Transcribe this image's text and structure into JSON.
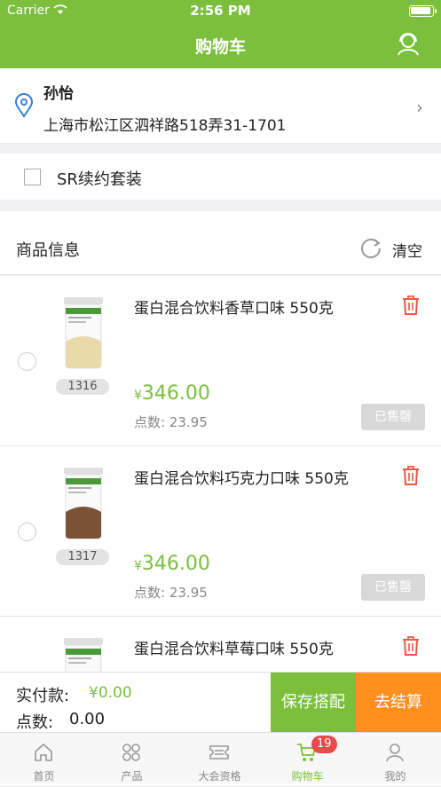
{
  "status_bar": {
    "carrier": "Carrier",
    "time": "2:56 PM"
  },
  "header": {
    "title": "购物车",
    "service_icon": "customer-service-icon"
  },
  "address": {
    "name": "孙怡",
    "line": "上海市松江区泗祥路518弄31-1701"
  },
  "sr_option": {
    "label": "SR续约套装",
    "checked": false
  },
  "goods": {
    "title": "商品信息",
    "clear_label": "清空"
  },
  "products": [
    {
      "name": "蛋白混合饮料香草口味 550克",
      "code": "1316",
      "currency": "¥",
      "price": "346.00",
      "points_label": "点数:",
      "points": "23.95",
      "status": "已售罄",
      "jar_color": "#e9d9a8"
    },
    {
      "name": "蛋白混合饮料巧克力口味 550克",
      "code": "1317",
      "currency": "¥",
      "price": "346.00",
      "points_label": "点数:",
      "points": "23.95",
      "status": "已售罄",
      "jar_color": "#7a5236"
    },
    {
      "name": "蛋白混合饮料草莓口味 550克",
      "code": "",
      "currency": "",
      "price": "",
      "points_label": "",
      "points": "",
      "status": "",
      "jar_color": "#e8a0a8"
    }
  ],
  "checkout": {
    "pay_label": "实付款:",
    "pay_amount": "¥0.00",
    "points_label": "点数:",
    "points_amount": "0.00",
    "save_button": "保存搭配",
    "pay_button": "去结算"
  },
  "tabbar": {
    "items": [
      {
        "label": "首页",
        "icon": "home-icon"
      },
      {
        "label": "产品",
        "icon": "products-icon"
      },
      {
        "label": "大会资格",
        "icon": "ticket-icon"
      },
      {
        "label": "购物车",
        "icon": "cart-icon",
        "badge": "19",
        "active": true
      },
      {
        "label": "我的",
        "icon": "profile-icon"
      }
    ]
  },
  "colors": {
    "primary": "#7bbf3d",
    "accent": "#ff8f1f",
    "danger": "#e8574a"
  }
}
